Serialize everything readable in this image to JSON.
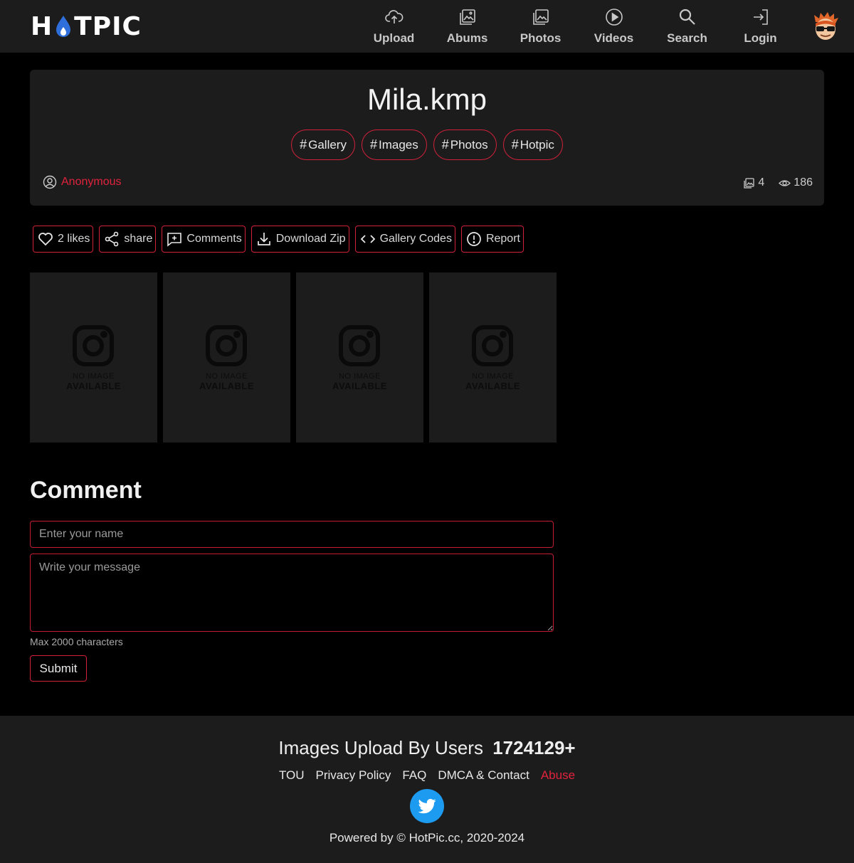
{
  "header": {
    "logo_text_left": "H",
    "logo_text_right": "TPIC",
    "nav": [
      {
        "label": "Upload",
        "icon": "cloud-upload-icon"
      },
      {
        "label": "Abums",
        "icon": "albums-icon"
      },
      {
        "label": "Photos",
        "icon": "photos-icon"
      },
      {
        "label": "Videos",
        "icon": "play-circle-icon"
      },
      {
        "label": "Search",
        "icon": "search-icon"
      },
      {
        "label": "Login",
        "icon": "login-icon"
      }
    ]
  },
  "gallery": {
    "title": "Mila.kmp",
    "tags": [
      "Gallery",
      "Images",
      "Photos",
      "Hotpic"
    ],
    "tag_prefix": "#",
    "author": "Anonymous",
    "image_count": "4",
    "view_count": "186"
  },
  "actions": {
    "likes": "2 likes",
    "share": "share",
    "comments": "Comments",
    "download": "Download Zip",
    "codes": "Gallery Codes",
    "report": "Report"
  },
  "thumbnails": [
    {
      "line1": "NO IMAGE",
      "line2": "AVAILABLE"
    },
    {
      "line1": "NO IMAGE",
      "line2": "AVAILABLE"
    },
    {
      "line1": "NO IMAGE",
      "line2": "AVAILABLE"
    },
    {
      "line1": "NO IMAGE",
      "line2": "AVAILABLE"
    }
  ],
  "comment": {
    "heading": "Comment",
    "name_placeholder": "Enter your name",
    "message_placeholder": "Write your message",
    "max_note": "Max 2000 characters",
    "submit": "Submit"
  },
  "footer": {
    "headline": "Images Upload By Users",
    "count": "1724129+",
    "links": [
      "TOU",
      "Privacy Policy",
      "FAQ",
      "DMCA & Contact"
    ],
    "abuse": "Abuse",
    "powered": "Powered by © HotPic.cc, 2020-2024"
  },
  "colors": {
    "accent": "#d0213a",
    "background": "#000000",
    "panel": "#1c1c1c",
    "twitter": "#1d9bf0"
  }
}
